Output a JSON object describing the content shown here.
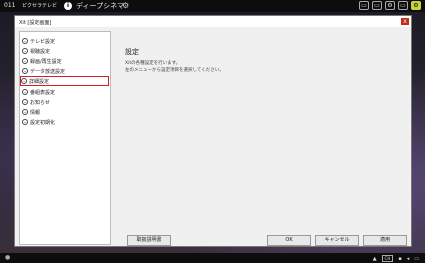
{
  "topbar": {
    "channel": "011",
    "app_name": "ピクセラテレビ",
    "info_icon": "i",
    "program": "ディープシネマ",
    "gear_icon": "⚙",
    "right_icons": [
      "▭",
      "▭",
      "⚙",
      "▭",
      "⚙"
    ]
  },
  "window": {
    "title": "Xit [設定画面]",
    "close": "x"
  },
  "sidebar": {
    "items": [
      {
        "label": "テレビ設定"
      },
      {
        "label": "視聴設定"
      },
      {
        "label": "録画/再生設定"
      },
      {
        "label": "データ放送設定"
      },
      {
        "label": "詳細設定"
      },
      {
        "label": "番組表設定"
      },
      {
        "label": "お知らせ"
      },
      {
        "label": "情報"
      },
      {
        "label": "設定初期化"
      }
    ]
  },
  "content": {
    "heading": "設定",
    "line1": "Xitの各種設定を行います。",
    "line2": "左のメニューから設定項目を選択してください。"
  },
  "buttons": {
    "manual": "取扱説明書",
    "ok": "OK",
    "cancel": "キャンセル",
    "apply": "適用"
  },
  "taskbar": {
    "left_icon": "●",
    "ime": "CH",
    "arrow": "▲"
  },
  "colors": {
    "highlight_box": "#d02020",
    "accent": "#c8d23a",
    "close_red": "#c42b1c"
  }
}
